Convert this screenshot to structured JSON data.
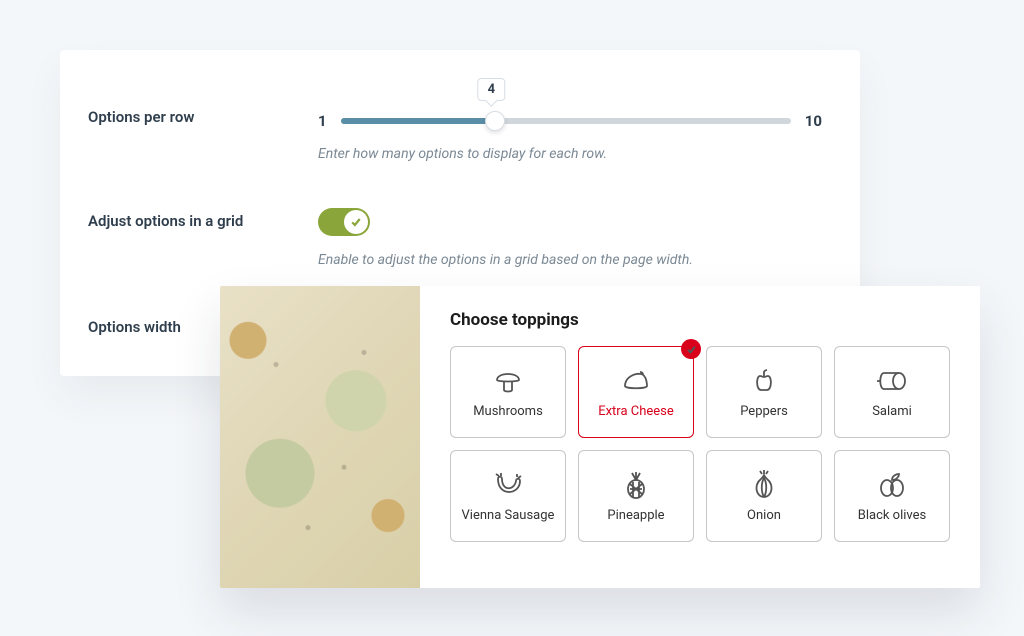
{
  "settings": {
    "options_per_row": {
      "label": "Options per row",
      "min": "1",
      "max": "10",
      "value": "4",
      "help": "Enter how many options to display for each row."
    },
    "adjust_grid": {
      "label": "Adjust options in a grid",
      "enabled": true,
      "help": "Enable to adjust the options in a grid based on the page width."
    },
    "options_width": {
      "label": "Options width"
    }
  },
  "preview": {
    "title": "Choose toppings",
    "toppings": [
      {
        "label": "Mushrooms",
        "icon": "mushroom-icon",
        "selected": false
      },
      {
        "label": "Extra Cheese",
        "icon": "cheese-icon",
        "selected": true
      },
      {
        "label": "Peppers",
        "icon": "pepper-icon",
        "selected": false
      },
      {
        "label": "Salami",
        "icon": "salami-icon",
        "selected": false
      },
      {
        "label": "Vienna Sausage",
        "icon": "sausage-icon",
        "selected": false
      },
      {
        "label": "Pineapple",
        "icon": "pineapple-icon",
        "selected": false
      },
      {
        "label": "Onion",
        "icon": "onion-icon",
        "selected": false
      },
      {
        "label": "Black olives",
        "icon": "olives-icon",
        "selected": false
      }
    ]
  },
  "colors": {
    "slider": "#5a8ea6",
    "toggle": "#8aa63a",
    "selected": "#d9001b"
  }
}
